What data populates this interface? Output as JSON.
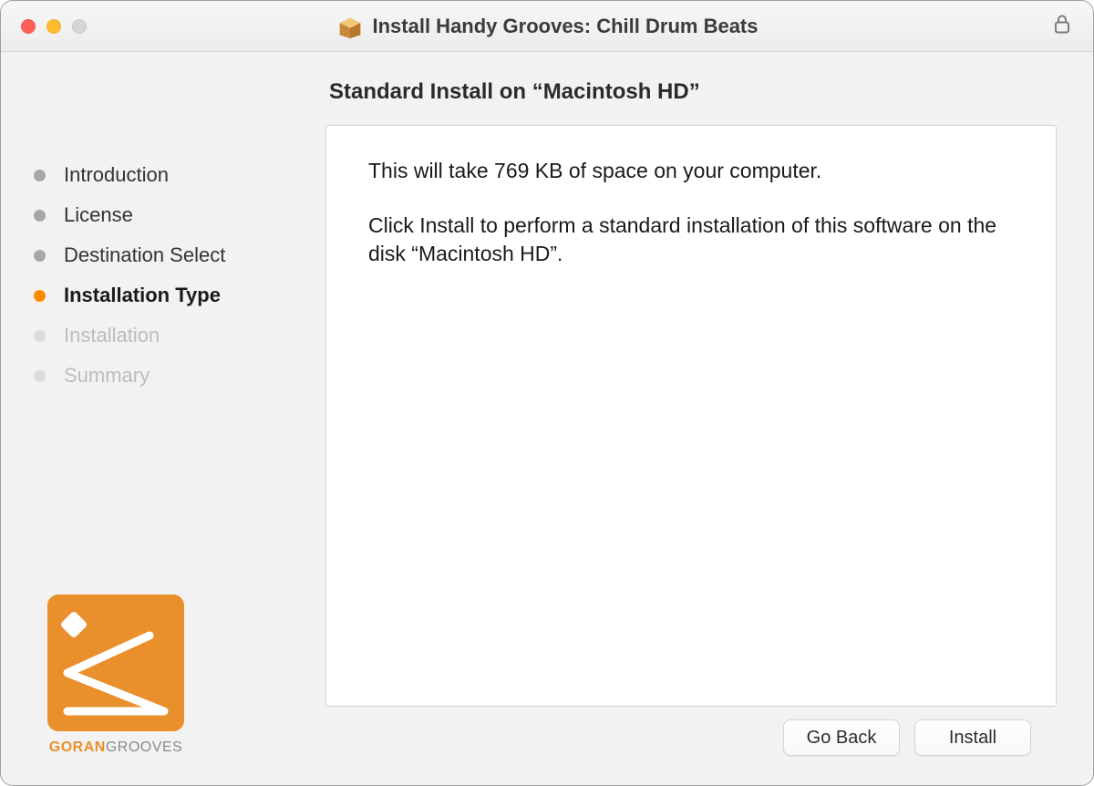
{
  "window": {
    "title": "Install Handy Grooves: Chill Drum Beats"
  },
  "sidebar": {
    "steps": [
      {
        "label": "Introduction",
        "state": "done"
      },
      {
        "label": "License",
        "state": "done"
      },
      {
        "label": "Destination Select",
        "state": "done"
      },
      {
        "label": "Installation Type",
        "state": "current"
      },
      {
        "label": "Installation",
        "state": "future"
      },
      {
        "label": "Summary",
        "state": "future"
      }
    ],
    "brand": {
      "line1": "GORAN",
      "line2": "GROOVES"
    }
  },
  "main": {
    "heading": "Standard Install on “Macintosh HD”",
    "space_line": "This will take 769 KB of space on your computer.",
    "instruction": "Click Install to perform a standard installation of this software on the disk “Macintosh HD”."
  },
  "footer": {
    "go_back": "Go Back",
    "install": "Install"
  }
}
